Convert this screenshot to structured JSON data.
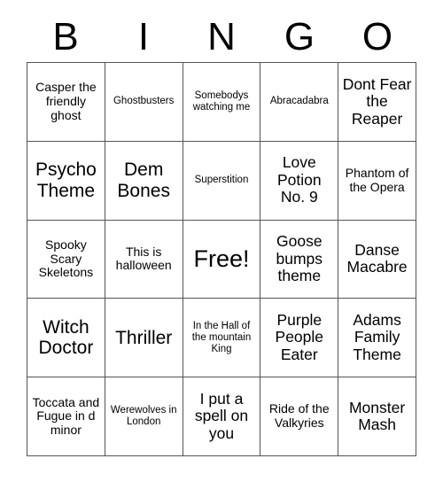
{
  "card": {
    "header_letters": [
      "B",
      "I",
      "N",
      "G",
      "O"
    ],
    "rows": [
      [
        {
          "text": "Casper the friendly ghost",
          "size": "sm"
        },
        {
          "text": "Ghostbusters",
          "size": "xs"
        },
        {
          "text": "Somebodys watching me",
          "size": "xs"
        },
        {
          "text": "Abracadabra",
          "size": "xs"
        },
        {
          "text": "Dont Fear the Reaper",
          "size": "md"
        }
      ],
      [
        {
          "text": "Psycho Theme",
          "size": "lg"
        },
        {
          "text": "Dem Bones",
          "size": "lg"
        },
        {
          "text": "Superstition",
          "size": "xs"
        },
        {
          "text": "Love Potion No. 9",
          "size": "md"
        },
        {
          "text": "Phantom of the Opera",
          "size": "sm"
        }
      ],
      [
        {
          "text": "Spooky Scary Skeletons",
          "size": "sm"
        },
        {
          "text": "This is halloween",
          "size": "sm"
        },
        {
          "text": "Free!",
          "size": "xl"
        },
        {
          "text": "Goose bumps theme",
          "size": "md"
        },
        {
          "text": "Danse Macabre",
          "size": "md"
        }
      ],
      [
        {
          "text": "Witch Doctor",
          "size": "lg"
        },
        {
          "text": "Thriller",
          "size": "lg"
        },
        {
          "text": "In the Hall of the mountain King",
          "size": "xs"
        },
        {
          "text": "Purple People Eater",
          "size": "md"
        },
        {
          "text": "Adams Family Theme",
          "size": "md"
        }
      ],
      [
        {
          "text": "Toccata and Fugue in d minor",
          "size": "sm"
        },
        {
          "text": "Werewolves in London",
          "size": "xs"
        },
        {
          "text": "I put a spell on you",
          "size": "md"
        },
        {
          "text": "Ride of the Valkyries",
          "size": "sm"
        },
        {
          "text": "Monster Mash",
          "size": "md"
        }
      ]
    ]
  },
  "colors": {
    "background": "#ffffff",
    "text": "#000000",
    "grid_line": "#555555"
  }
}
